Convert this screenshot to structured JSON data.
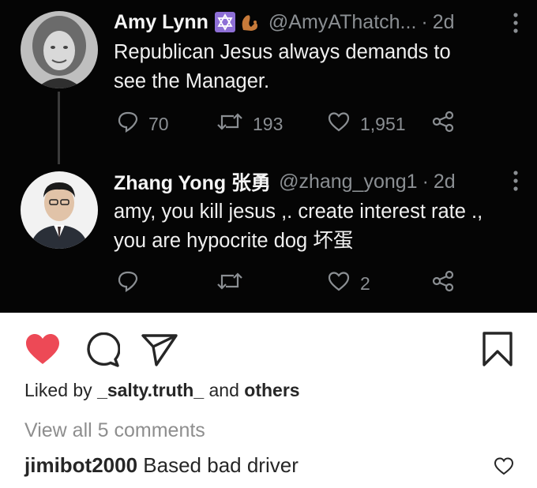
{
  "tweets": [
    {
      "name": "Amy Lynn",
      "handle": "@AmyAThatch...",
      "separator": "·",
      "time": "2d",
      "body_lines": [
        "Republican Jesus always demands to",
        "see the Manager."
      ],
      "replies": "70",
      "retweets": "193",
      "likes": "1,951"
    },
    {
      "name": "Zhang Yong 张勇",
      "handle": "@zhang_yong1",
      "separator": "·",
      "time": "2d",
      "body_lines": [
        "amy, you kill jesus ,. create interest rate .,",
        "you are hypocrite dog 坏蛋"
      ],
      "likes": "2"
    }
  ],
  "post": {
    "liked_prefix": "Liked by ",
    "liked_user": "_salty.truth_",
    "liked_mid": " and ",
    "liked_others": "others",
    "view_all": "View all 5 comments",
    "comment_user": "jimibot2000",
    "comment_text": " Based bad driver"
  },
  "colors": {
    "like_red": "#ed4956",
    "tweet_bg": "#050505",
    "tweet_muted": "#8b8f93"
  },
  "icons": [
    "reply-icon",
    "retweet-icon",
    "like-icon",
    "share-icon",
    "more-icon",
    "heart-filled-icon",
    "comment-icon",
    "send-icon",
    "bookmark-icon",
    "comment-heart-icon"
  ]
}
